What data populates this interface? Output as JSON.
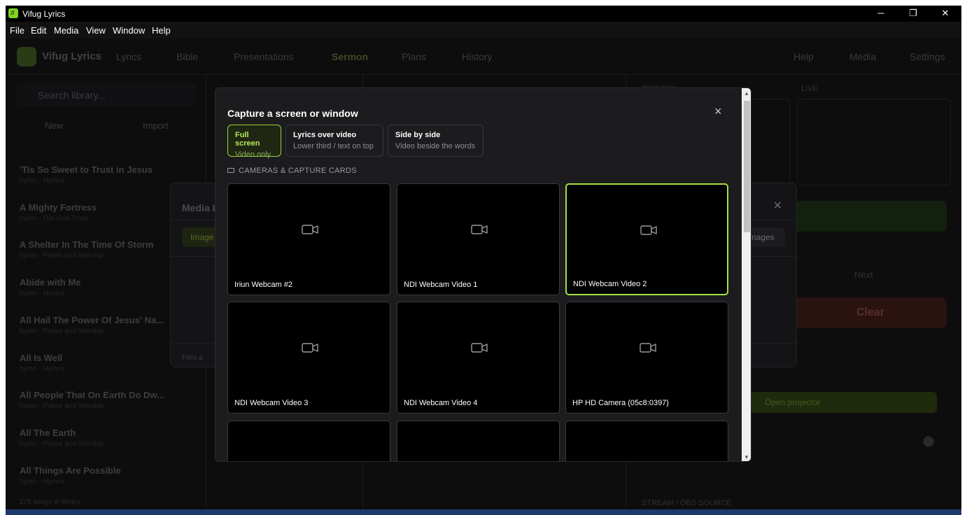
{
  "window": {
    "title": "Vifug Lyrics",
    "minimize": "─",
    "maximize": "❐",
    "close": "✕"
  },
  "menu": [
    "File",
    "Edit",
    "Media",
    "View",
    "Window",
    "Help"
  ],
  "header": {
    "brand": "Vifug Lyrics",
    "nav": [
      "Lyrics",
      "Bible",
      "Presentations",
      "Sermon",
      "Plans",
      "History"
    ],
    "right": [
      "Help",
      "Media",
      "Settings"
    ]
  },
  "sidebar": {
    "search_placeholder": "Search library...",
    "new_label": "New",
    "import_label": "Import",
    "songs": [
      {
        "title": "'Tis So Sweet to Trust in Jesus",
        "sub": "hymn · Hymns"
      },
      {
        "title": "A Mighty Fortress",
        "sub": "hymn · Our God Trust"
      },
      {
        "title": "A Shelter In The Time Of Storm",
        "sub": "hymn · Praise and Worship"
      },
      {
        "title": "Abide with Me",
        "sub": "hymn · Hymns"
      },
      {
        "title": "All Hail The Power Of Jesus' Na...",
        "sub": "hymn · Praise and Worship"
      },
      {
        "title": "All Is Well",
        "sub": "hymn · Hymns"
      },
      {
        "title": "All People That On Earth Do Dw...",
        "sub": "hymn · Praise and Worship"
      },
      {
        "title": "All The Earth",
        "sub": "hymn · Praise and Worship"
      },
      {
        "title": "All Things Are Possible",
        "sub": "hymn · Hymns"
      }
    ],
    "count": "275 songs in library"
  },
  "right_panel": {
    "preview_label": "PREVIEW",
    "live_label": "LIVE",
    "next_label": "Next",
    "clear_label": "Clear",
    "projector_label": "Open projector",
    "stream_label": "STREAM / OBS SOURCE"
  },
  "media_dialog": {
    "title": "Media L",
    "tab_left": "Image",
    "tab_right": "Images",
    "footer": "Files a"
  },
  "capture": {
    "title": "Capture a screen or window",
    "close": "×",
    "modes": [
      {
        "label": "Full screen",
        "sub": "Video only",
        "active": true
      },
      {
        "label": "Lyrics over video",
        "sub": "Lower third / text on top",
        "active": false
      },
      {
        "label": "Side by side",
        "sub": "Video beside the words",
        "active": false
      }
    ],
    "section": "CAMERAS & CAPTURE CARDS",
    "sources": [
      {
        "name": "Iriun Webcam #2",
        "selected": false
      },
      {
        "name": "NDI Webcam Video 1",
        "selected": false
      },
      {
        "name": "NDI Webcam Video 2",
        "selected": true
      },
      {
        "name": "NDI Webcam Video 3",
        "selected": false
      },
      {
        "name": "NDI Webcam Video 4",
        "selected": false
      },
      {
        "name": "HP HD Camera (05c8:0397)",
        "selected": false
      },
      {
        "name": "",
        "selected": false
      },
      {
        "name": "",
        "selected": false
      },
      {
        "name": "",
        "selected": false
      }
    ]
  },
  "colors": {
    "accent": "#a5e040",
    "accent_dim": "#1f2713",
    "modal_bg": "#1c1c1f"
  }
}
